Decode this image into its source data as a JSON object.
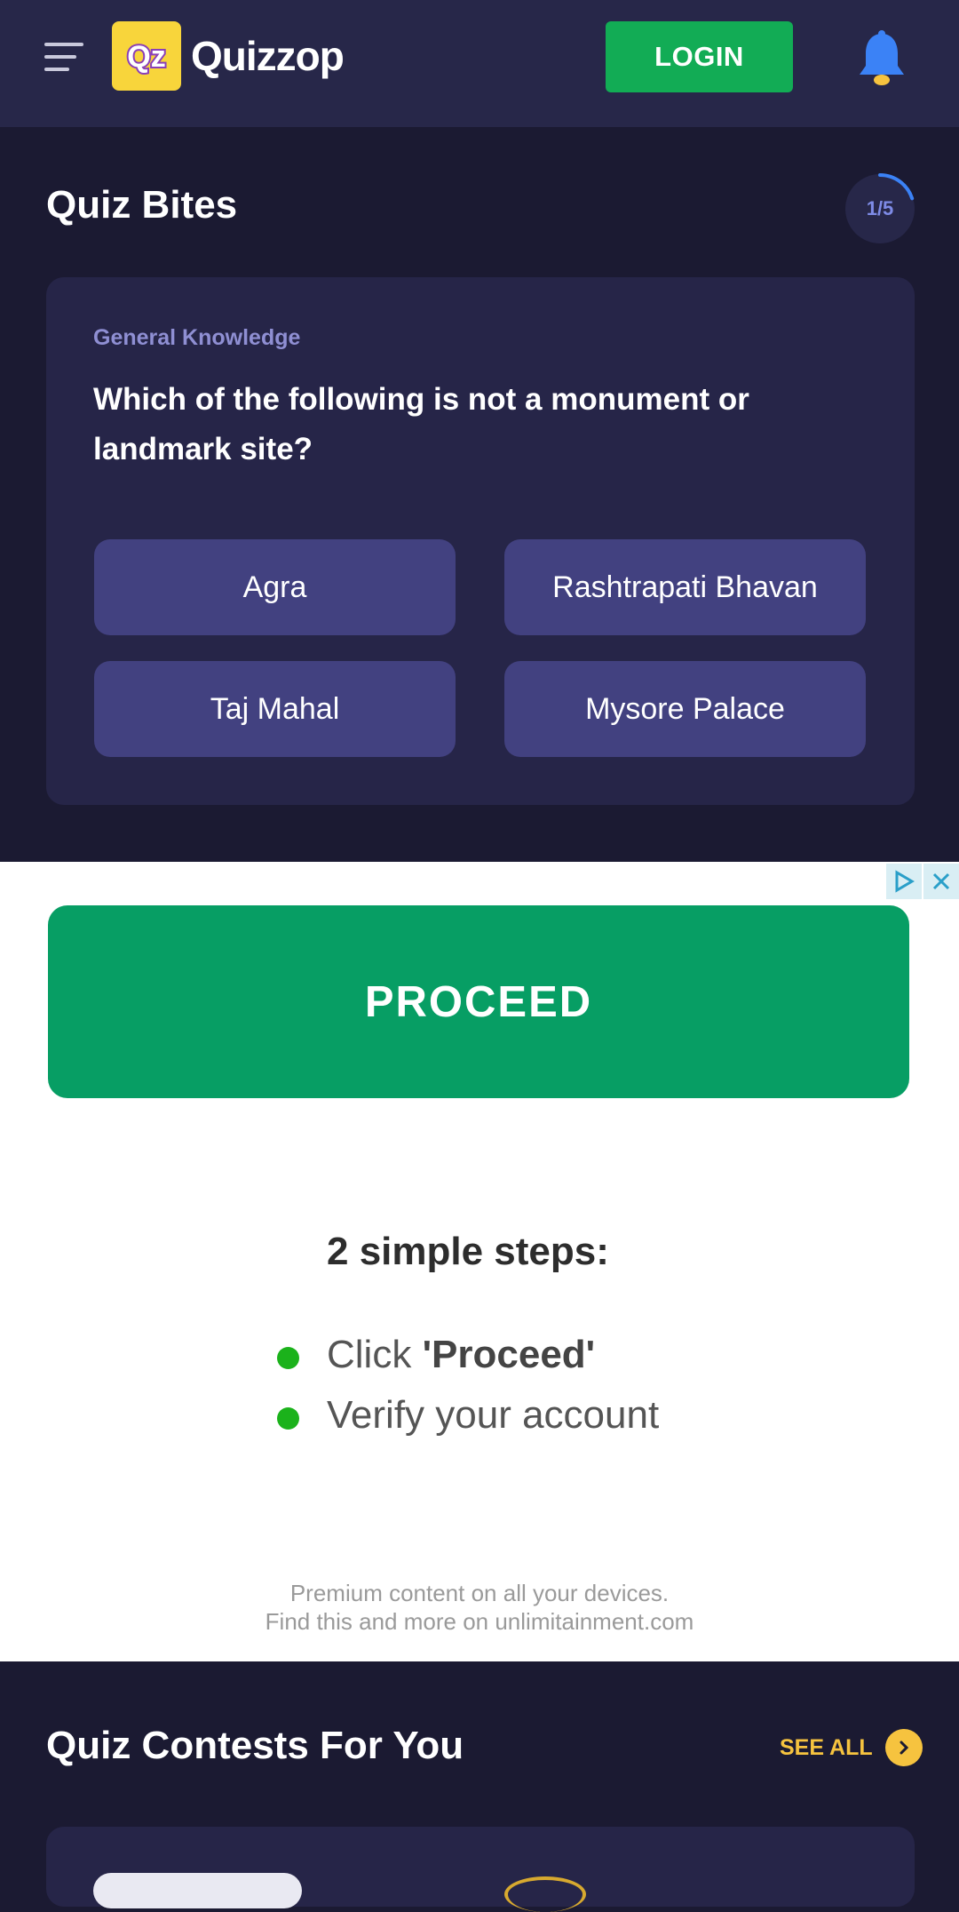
{
  "header": {
    "logo_letters": "Qz",
    "brand": "Quizzop",
    "login_label": "LOGIN",
    "menu_icon": "hamburger-icon",
    "bell_icon": "bell-icon",
    "bell_color": "#3b82f6",
    "login_color": "#12ac55"
  },
  "quiz_bites": {
    "title": "Quiz Bites",
    "progress_label": "1/5",
    "progress_fraction": 0.2,
    "category": "General Knowledge",
    "question": "Which of the following is not a monument or landmark site?",
    "options": [
      "Agra",
      "Rashtrapati Bhavan",
      "Taj Mahal",
      "Mysore Palace"
    ]
  },
  "ad": {
    "proceed_label": "PROCEED",
    "steps_title": "2 simple steps:",
    "step1_prefix": "Click ",
    "step1_bold": "'Proceed'",
    "step2": "Verify your account",
    "footer_line1": "Premium content on all your devices.",
    "footer_line2": "Find this and more on unlimitainment.com",
    "adchoices_icon": "adchoices-icon",
    "close_icon": "close-icon"
  },
  "contests": {
    "title": "Quiz Contests For You",
    "see_all_label": "SEE ALL",
    "see_all_icon": "chevron-right-icon"
  }
}
